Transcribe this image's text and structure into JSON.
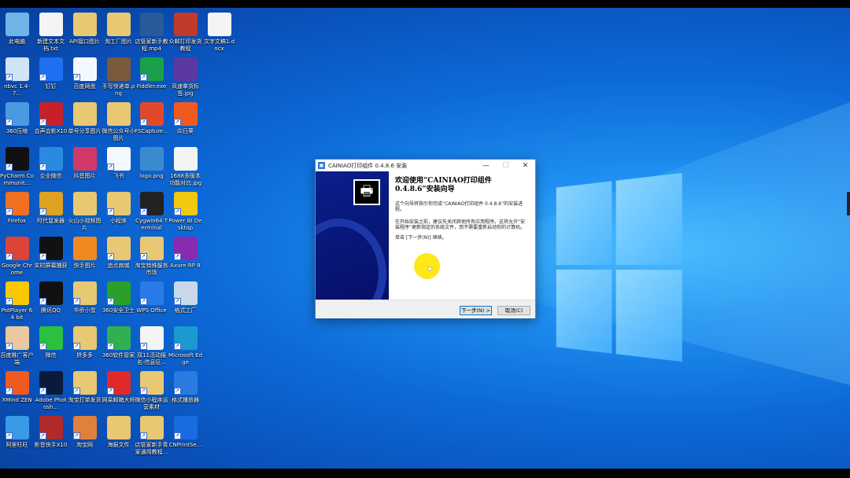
{
  "desktop": {
    "icons": [
      {
        "label": "此电脑",
        "color": "#6fb4e8",
        "col": 0,
        "row": 0
      },
      {
        "label": "新建文本文档.txt",
        "color": "#f4f4f4",
        "col": 1,
        "row": 0
      },
      {
        "label": "API接口图片",
        "color": "#e8c872",
        "col": 2,
        "row": 0
      },
      {
        "label": "淘工厂图片",
        "color": "#e8c872",
        "col": 3,
        "row": 0
      },
      {
        "label": "店管家新手教程.mp4",
        "color": "#2a5a9a",
        "col": 4,
        "row": 0
      },
      {
        "label": "众邮打印发货教程",
        "color": "#c0392b",
        "col": 5,
        "row": 0
      },
      {
        "label": "文字文稿1.docx",
        "color": "#f4f4f4",
        "col": 6,
        "row": 0
      },
      {
        "label": "nbvc 1.4-7...",
        "color": "#cfe4f4",
        "col": 0,
        "row": 1
      },
      {
        "label": "钉钉",
        "color": "#1f6ff0",
        "col": 1,
        "row": 1
      },
      {
        "label": "百度网盘",
        "color": "#f4f8ff",
        "col": 2,
        "row": 1
      },
      {
        "label": "手写快递单.png",
        "color": "#7a5a3a",
        "col": 3,
        "row": 1
      },
      {
        "label": "Fiddler.exe",
        "color": "#1aa04a",
        "col": 4,
        "row": 1
      },
      {
        "label": "风速拿货标签.jpg",
        "color": "#5a3aa0",
        "col": 5,
        "row": 1
      },
      {
        "label": "360压缩",
        "color": "#4a9ae0",
        "col": 0,
        "row": 2
      },
      {
        "label": "会声会影X10",
        "color": "#c8202a",
        "col": 1,
        "row": 2
      },
      {
        "label": "单号分享图片",
        "color": "#e8c872",
        "col": 2,
        "row": 2
      },
      {
        "label": "微信公众号小图片",
        "color": "#e8c872",
        "col": 3,
        "row": 2
      },
      {
        "label": "FSCapture...",
        "color": "#e04a2a",
        "col": 4,
        "row": 2
      },
      {
        "label": "向日葵",
        "color": "#f05a20",
        "col": 5,
        "row": 2
      },
      {
        "label": "PyCharm Communit...",
        "color": "#111111",
        "col": 0,
        "row": 3
      },
      {
        "label": "企业微信",
        "color": "#2a8ae0",
        "col": 1,
        "row": 3
      },
      {
        "label": "抖音图片",
        "color": "#d03a6a",
        "col": 2,
        "row": 3
      },
      {
        "label": "飞书",
        "color": "#f4f8ff",
        "col": 3,
        "row": 3
      },
      {
        "label": "logo.png",
        "color": "#3a8ad0",
        "col": 4,
        "row": 3
      },
      {
        "label": "1688多版本功能对比.jpg",
        "color": "#f4f4f4",
        "col": 5,
        "row": 3
      },
      {
        "label": "Firefox",
        "color": "#f07020",
        "col": 0,
        "row": 4
      },
      {
        "label": "时代鼠发器",
        "color": "#e0a020",
        "col": 1,
        "row": 4
      },
      {
        "label": "火山小视频图片",
        "color": "#e8c872",
        "col": 2,
        "row": 4
      },
      {
        "label": "小程序",
        "color": "#e8c872",
        "col": 3,
        "row": 4
      },
      {
        "label": "Cygwin64 Terminal",
        "color": "#222222",
        "col": 4,
        "row": 4
      },
      {
        "label": "Power BI Desktop",
        "color": "#f2c811",
        "col": 5,
        "row": 4
      },
      {
        "label": "Google Chrome",
        "color": "#db4437",
        "col": 0,
        "row": 5
      },
      {
        "label": "实时屏幕捕获",
        "color": "#111111",
        "col": 1,
        "row": 5
      },
      {
        "label": "快手图片",
        "color": "#f08a20",
        "col": 2,
        "row": 5
      },
      {
        "label": "追点商城",
        "color": "#e8c872",
        "col": 3,
        "row": 5
      },
      {
        "label": "淘宝特殊服务市场",
        "color": "#e8c872",
        "col": 4,
        "row": 5
      },
      {
        "label": "Axure RP 8",
        "color": "#8a2ab0",
        "col": 5,
        "row": 5
      },
      {
        "label": "PotPlayer 64 bit",
        "color": "#f8c800",
        "col": 0,
        "row": 6
      },
      {
        "label": "腾讯QQ",
        "color": "#111111",
        "col": 1,
        "row": 6
      },
      {
        "label": "华侨小雪",
        "color": "#e8c872",
        "col": 2,
        "row": 6
      },
      {
        "label": "360安全卫士",
        "color": "#2aa02a",
        "col": 3,
        "row": 6
      },
      {
        "label": "WPS Office",
        "color": "#2a7ae8",
        "col": 4,
        "row": 6
      },
      {
        "label": "格式工厂",
        "color": "#c8d8e8",
        "col": 5,
        "row": 6
      },
      {
        "label": "百度推广客户端",
        "color": "#e8c8a0",
        "col": 0,
        "row": 7
      },
      {
        "label": "微信",
        "color": "#2ac040",
        "col": 1,
        "row": 7
      },
      {
        "label": "拼多多",
        "color": "#e8c872",
        "col": 2,
        "row": 7
      },
      {
        "label": "360软件管家",
        "color": "#30b050",
        "col": 3,
        "row": 7
      },
      {
        "label": "双11活动报名-信息征...",
        "color": "#f4f4f4",
        "col": 4,
        "row": 7
      },
      {
        "label": "Microsoft Edge",
        "color": "#1a9ad0",
        "col": 5,
        "row": 7
      },
      {
        "label": "XMind ZEN",
        "color": "#f05a20",
        "col": 0,
        "row": 8
      },
      {
        "label": "Adobe Photosh...",
        "color": "#0a1a3a",
        "col": 1,
        "row": 8
      },
      {
        "label": "淘宝打单发货",
        "color": "#e8c872",
        "col": 2,
        "row": 8
      },
      {
        "label": "网易邮箱大师",
        "color": "#e02a2a",
        "col": 3,
        "row": 8
      },
      {
        "label": "微信小程序运营素材",
        "color": "#e8c872",
        "col": 4,
        "row": 8
      },
      {
        "label": "格式播放器",
        "color": "#2a7ae0",
        "col": 5,
        "row": 8
      },
      {
        "label": "阿里旺旺",
        "color": "#3a9ae8",
        "col": 0,
        "row": 9
      },
      {
        "label": "影音快手X10",
        "color": "#b02a2a",
        "col": 1,
        "row": 9
      },
      {
        "label": "淘宝网",
        "color": "#e0803a",
        "col": 2,
        "row": 9
      },
      {
        "label": "海报文件",
        "color": "#e8c872",
        "col": 3,
        "row": 9
      },
      {
        "label": "店管家新手青家通用教程...",
        "color": "#e8c872",
        "col": 4,
        "row": 9
      },
      {
        "label": "CNPrintSe...",
        "color": "#1a6ae0",
        "col": 5,
        "row": 9
      }
    ]
  },
  "dialog": {
    "title": "CAINIAO打印组件 0.4.8.6 安装",
    "heading": "欢迎使用“CAINIAO打印组件 0.4.8.6”安装向导",
    "para1": "这个向导将指引你完成“CAINIAO打印组件 0.4.8.6”的安装进程。",
    "para2": "在开始安装之前，建议先关闭其他所有应用程序。这将允许“安装程序”更新指定的系统文件，而不需要重新启动你的计算机。",
    "para3": "单击 [下一步(N)] 继续。",
    "next_label": "下一步(N) >",
    "cancel_label": "取消(C)",
    "minimize": "—",
    "maximize": "☐",
    "close": "✕"
  }
}
